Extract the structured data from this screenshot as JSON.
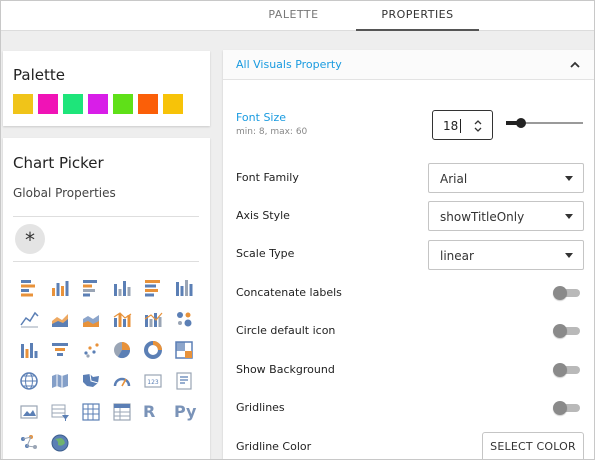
{
  "tabs": [
    {
      "label": "PALETTE",
      "active": false
    },
    {
      "label": "PROPERTIES",
      "active": true
    }
  ],
  "palette": {
    "title": "Palette",
    "colors": [
      "#f0c419",
      "#f013b6",
      "#1ee57a",
      "#d81ee8",
      "#5fe018",
      "#fb5f08",
      "#f7c308"
    ]
  },
  "chart_picker": {
    "title": "Chart Picker",
    "subtitle": "Global Properties",
    "all_icon": "*",
    "icons": [
      "bar-chart-icon",
      "stacked-bar-chart-icon",
      "horizontal-bar-chart-icon",
      "grouped-column-chart-icon",
      "stacked-horizontal-bar-icon",
      "column-chart-icon",
      "line-chart-icon",
      "area-chart-icon",
      "stacked-area-chart-icon",
      "bar-line-combo-icon",
      "column-line-combo-icon",
      "bubble-matrix-icon",
      "vertical-bar-alt-icon",
      "funnel-chart-icon",
      "scatter-plot-icon",
      "pie-chart-icon",
      "donut-chart-icon",
      "treemap-icon",
      "globe-icon",
      "region-map-icon",
      "choropleth-map-icon",
      "gauge-icon",
      "number-kpi-icon",
      "text-card-icon",
      "image-card-icon",
      "filter-table-icon",
      "pivot-table-icon",
      "data-table-icon",
      "r-script-icon",
      "python-script-icon",
      "network-graph-icon",
      "world-globe-icon"
    ],
    "text_icons": {
      "r-script-icon": "R",
      "python-script-icon": "Py"
    }
  },
  "properties": {
    "section_title": "All Visuals Property",
    "font_size": {
      "label": "Font Size",
      "hint": "min: 8, max: 60",
      "value": "18",
      "min": 8,
      "max": 60
    },
    "font_family": {
      "label": "Font Family",
      "value": "Arial"
    },
    "axis_style": {
      "label": "Axis Style",
      "value": "showTitleOnly"
    },
    "scale_type": {
      "label": "Scale Type",
      "value": "linear"
    },
    "concatenate_labels": {
      "label": "Concatenate labels",
      "enabled": false
    },
    "circle_default_icon": {
      "label": "Circle default icon",
      "enabled": false
    },
    "show_background": {
      "label": "Show Background",
      "enabled": false
    },
    "gridlines": {
      "label": "Gridlines",
      "enabled": false
    },
    "gridline_color": {
      "label": "Gridline Color",
      "button": "SELECT COLOR"
    }
  },
  "colors": {
    "accent": "#1a9be0",
    "icon_blue": "#5b7fb5",
    "icon_orange": "#e8923a"
  }
}
